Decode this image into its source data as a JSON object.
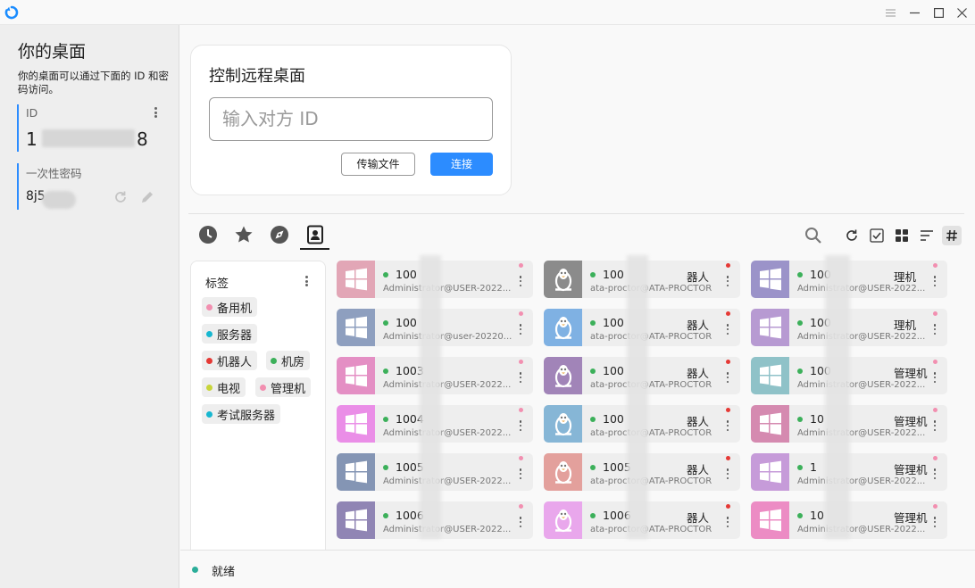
{
  "titlebar": {
    "icons": [
      "rustdesk-logo-icon",
      "hamburger-menu-icon",
      "minimize-icon",
      "maximize-icon",
      "close-icon"
    ]
  },
  "left_panel": {
    "title": "你的桌面",
    "description": "你的桌面可以通过下面的 ID 和密码访问。",
    "id_label": "ID",
    "id_value_prefix": "1",
    "id_value_suffix": "8",
    "password_label": "一次性密码",
    "password_value": "8j5",
    "accent_color": "#2c8cff"
  },
  "remote": {
    "title": "控制远程桌面",
    "input_placeholder": "输入对方 ID",
    "transfer_label": "传输文件",
    "connect_label": "连接"
  },
  "tabs": [
    {
      "name": "recent-sessions-tab",
      "icon": "clock-icon",
      "active": false
    },
    {
      "name": "favorites-tab",
      "icon": "star-icon",
      "active": false
    },
    {
      "name": "discovered-tab",
      "icon": "compass-icon",
      "active": false
    },
    {
      "name": "address-book-tab",
      "icon": "contacts-icon",
      "active": true
    }
  ],
  "tags": {
    "title": "标签",
    "items": [
      {
        "label": "备用机",
        "color": "#f28fb0"
      },
      {
        "label": "服务器",
        "color": "#17b7d0"
      },
      {
        "label": "机器人",
        "color": "#e53935"
      },
      {
        "label": "机房",
        "color": "#3cb05a"
      },
      {
        "label": "电视",
        "color": "#c8d53a"
      },
      {
        "label": "管理机",
        "color": "#f28fb0"
      },
      {
        "label": "考试服务器",
        "color": "#17b7d0"
      }
    ]
  },
  "peers": [
    {
      "name": "100",
      "user": "Administrator@USER-2022...",
      "os": "windows",
      "thumb": "#e2a6b6",
      "tag": "#f28fb0"
    },
    {
      "name": "100",
      "user": "ata-proctor@ATA-PROCTOR",
      "os": "linux",
      "thumb": "#8b8b8b",
      "tag": "#e53935",
      "name_suffix": "器人"
    },
    {
      "name": "100",
      "user": "Administrator@USER-2022...",
      "os": "windows",
      "thumb": "#9b93c9",
      "tag": "#f28fb0",
      "name_suffix": "理机"
    },
    {
      "name": "100",
      "user": "Administrator@user-20220...",
      "os": "windows",
      "thumb": "#8e9fbf",
      "tag": "#f28fb0"
    },
    {
      "name": "100",
      "user": "ata-proctor@ATA-PROCTOR",
      "os": "linux",
      "thumb": "#7fb1e3",
      "tag": "#e53935",
      "name_suffix": "器人"
    },
    {
      "name": "100",
      "user": "Administrator@USER-2022...",
      "os": "windows",
      "thumb": "#b79ad2",
      "tag": "#f28fb0",
      "name_suffix": "理机"
    },
    {
      "name": "1003",
      "user": "Administrator@USER-2022...",
      "os": "windows",
      "thumb": "#e48fc4",
      "tag": "#f28fb0"
    },
    {
      "name": "100",
      "user": "ata-proctor@ATA-PROCTOR",
      "os": "linux",
      "thumb": "#a184b8",
      "tag": "#e53935",
      "name_suffix": "器人"
    },
    {
      "name": "100",
      "user": "Administrator@USER-2022...",
      "os": "windows",
      "thumb": "#8fc2c8",
      "tag": "#f28fb0",
      "name_suffix": "管理机"
    },
    {
      "name": "1004",
      "user": "Administrator@USER-2022...",
      "os": "windows",
      "thumb": "#ea8ee7",
      "tag": "#f28fb0"
    },
    {
      "name": "100",
      "user": "ata-proctor@ATA-PROCTOR",
      "os": "linux",
      "thumb": "#86b6d6",
      "tag": "#e53935",
      "name_suffix": "器人"
    },
    {
      "name": "10",
      "user": "Administrator@USER-2022...",
      "os": "windows",
      "thumb": "#d58ab0",
      "tag": "#f28fb0",
      "name_suffix": "管理机"
    },
    {
      "name": "1005",
      "user": "Administrator@USER-2022...",
      "os": "windows",
      "thumb": "#8495b4",
      "tag": "#f28fb0"
    },
    {
      "name": "1005",
      "user": "ata-proctor@ATA-PROCTOR",
      "os": "linux",
      "thumb": "#e3a09c",
      "tag": "#e53935",
      "name_suffix": "器人"
    },
    {
      "name": "1",
      "user": "Administrator@USER-2022...",
      "os": "windows",
      "thumb": "#c69bd9",
      "tag": "#f28fb0",
      "name_suffix": "管理机"
    },
    {
      "name": "1006",
      "user": "Administrator@USER-2022...",
      "os": "windows",
      "thumb": "#9085b4",
      "tag": "#f28fb0"
    },
    {
      "name": "1006",
      "user": "ata-proctor@ATA-PROCTOR",
      "os": "linux",
      "thumb": "#e9a7ec",
      "tag": "#e53935",
      "name_suffix": "器人"
    },
    {
      "name": "10",
      "user": "Administrator@USER-2022...",
      "os": "windows",
      "thumb": "#ec8cc4",
      "tag": "#f28fb0",
      "name_suffix": "管理机"
    }
  ],
  "status": {
    "text": "就绪",
    "color": "#2cae9a"
  }
}
